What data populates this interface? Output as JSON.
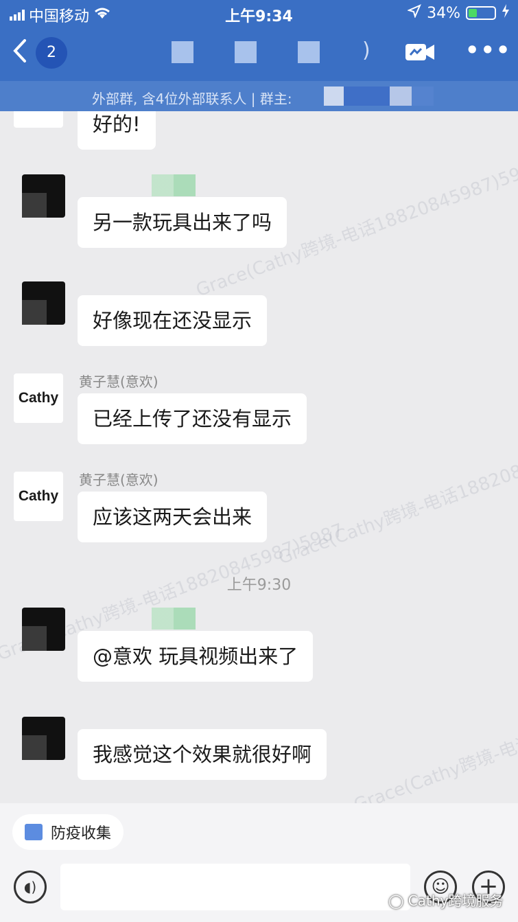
{
  "status_bar": {
    "carrier": "中国移动",
    "time": "上午9:34",
    "battery": "34%",
    "battery_level": 0.34
  },
  "header": {
    "unread_count": "2",
    "title_suffix": ")"
  },
  "group_info": {
    "text": "外部群, 含4位外部联系人 | 群主:"
  },
  "watermark": {
    "text": "Grace(Cathy跨境-电话18820845987)5987"
  },
  "messages": [
    {
      "sender": "",
      "text": "好的!"
    },
    {
      "sender": "",
      "text": "另一款玩具出来了吗"
    },
    {
      "sender": "",
      "text": "好像现在还没显示"
    },
    {
      "sender": "黄子慧(意欢)",
      "avatar_text": "Cathy",
      "text": "已经上传了还没有显示"
    },
    {
      "sender": "黄子慧(意欢)",
      "avatar_text": "Cathy",
      "text": "应该这两天会出来"
    },
    {
      "sender": "",
      "text": "@意欢 玩具视频出来了"
    },
    {
      "sender": "",
      "text": "我感觉这个效果就很好啊"
    }
  ],
  "timestamp": "上午9:30",
  "toolbar": {
    "chip_label": "防疫收集"
  },
  "footer_watermark": "Cathy跨境服务",
  "colors": {
    "header": "#3a6fc4",
    "subheader": "#4e7fcb",
    "chat_bg": "#ebebed",
    "bubble": "#ffffff"
  }
}
